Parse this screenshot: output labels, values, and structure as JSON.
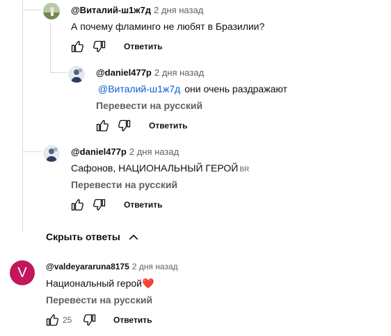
{
  "thread": {
    "replies": [
      {
        "handle": "@Виталий-ш1ж7д",
        "time": "2 дня назад",
        "text": "А почему фламинго не любят в Бразилии?",
        "reply_label": "Ответить"
      },
      {
        "handle": "@daniel477p",
        "time": "2 дня назад",
        "mention": "@Виталий-ш1ж7д",
        "text": "они очень раздражают",
        "translate": "Перевести на русский",
        "reply_label": "Ответить"
      },
      {
        "handle": "@daniel477p",
        "time": "2 дня назад",
        "text": "Сафонов, НАЦИОНАЛЬНЫЙ ГЕРОЙ",
        "suffix": "BR",
        "translate": "Перевести на русский",
        "reply_label": "Ответить"
      }
    ],
    "hide_replies": "Скрыть ответы"
  },
  "comment": {
    "avatar_letter": "V",
    "avatar_color": "#c2185b",
    "handle": "@valdeyararuna8175",
    "time": "2 дня назад",
    "text": "Национальный герой",
    "emoji": "❤️",
    "translate": "Перевести на русский",
    "likes": "25",
    "reply_label": "Ответить"
  },
  "icons": [
    "thumb-up-icon",
    "thumb-down-icon",
    "chevron-up-icon"
  ]
}
